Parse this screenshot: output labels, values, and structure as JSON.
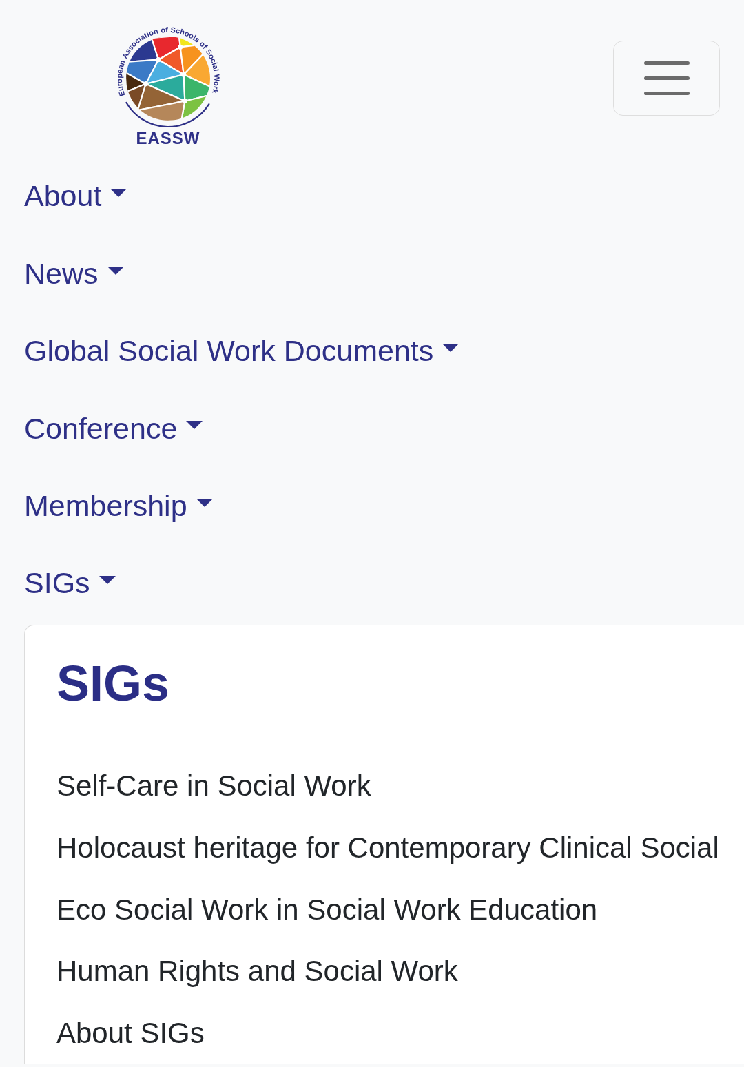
{
  "logo": {
    "ring_words": [
      "European",
      "Association",
      "of",
      "Schools",
      "of",
      "Social",
      "Work"
    ],
    "wordmark": "EASSW"
  },
  "nav": {
    "items": [
      {
        "label": "About",
        "dropdown": true
      },
      {
        "label": "News",
        "dropdown": true
      },
      {
        "label": "Global Social Work Documents",
        "dropdown": true
      },
      {
        "label": "Conference",
        "dropdown": true
      },
      {
        "label": "Membership",
        "dropdown": true
      },
      {
        "label": "SIGs",
        "dropdown": true
      }
    ]
  },
  "sigs_card": {
    "title": "SIGs",
    "links": [
      "Self-Care in Social Work",
      "Holocaust heritage for Contemporary Clinical Social",
      "Eco Social Work in Social Work Education",
      "Human Rights and Social Work",
      "About SIGs"
    ]
  }
}
